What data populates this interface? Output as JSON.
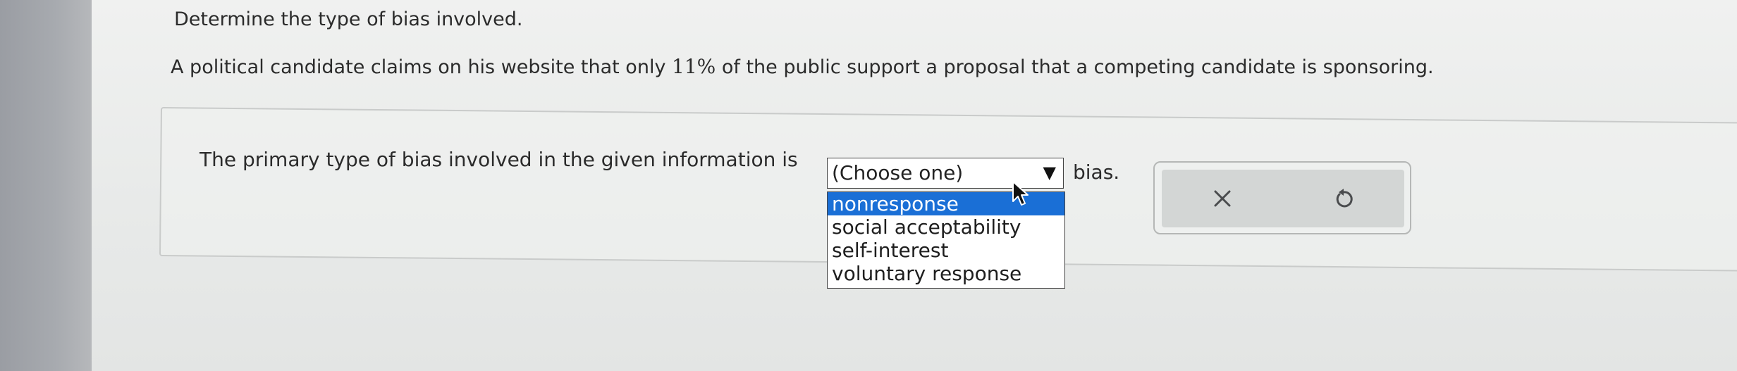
{
  "instruction": "Determine the type of bias involved.",
  "question": {
    "before": "A political candidate claims on his ",
    "website_word": "website",
    "middle": " that only ",
    "percent": "11%",
    "after": " of the public support a proposal that a competing candidate is sponsoring."
  },
  "answer": {
    "prompt": "The primary type of bias involved in the given information is",
    "select_value": "(Choose one)",
    "select_arrow": "▼",
    "suffix": "bias.",
    "options": [
      "nonresponse",
      "social acceptability",
      "self-interest",
      "voluntary response"
    ],
    "highlighted_index": 0
  },
  "actions": {
    "clear_icon": "x-icon",
    "retry_icon": "undo-icon"
  },
  "colors": {
    "highlight": "#1a6fd6",
    "text": "#2b2b2b",
    "button_panel": "#d3d6d5"
  }
}
